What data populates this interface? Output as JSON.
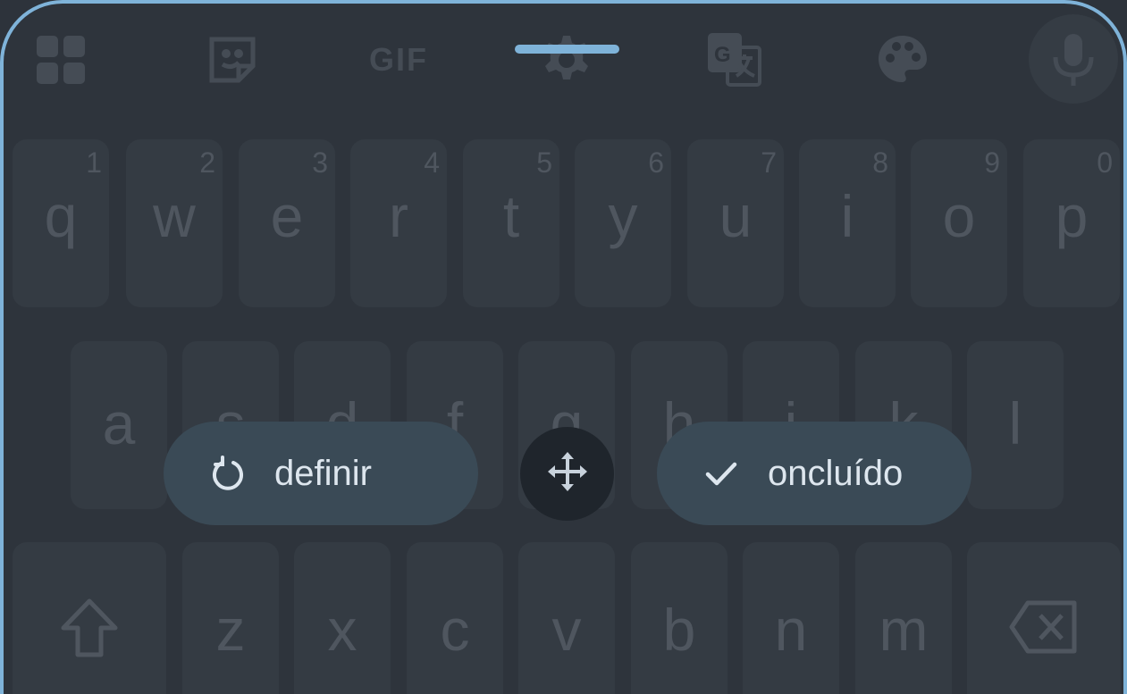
{
  "toolbar": {
    "icons": [
      "apps-grid-icon",
      "sticker-icon",
      "gif-icon",
      "settings-icon",
      "translate-icon",
      "palette-icon",
      "mic-icon"
    ],
    "gif_label": "GIF"
  },
  "keyboard": {
    "row1": [
      {
        "ch": "q",
        "num": "1"
      },
      {
        "ch": "w",
        "num": "2"
      },
      {
        "ch": "e",
        "num": "3"
      },
      {
        "ch": "r",
        "num": "4"
      },
      {
        "ch": "t",
        "num": "5"
      },
      {
        "ch": "y",
        "num": "6"
      },
      {
        "ch": "u",
        "num": "7"
      },
      {
        "ch": "i",
        "num": "8"
      },
      {
        "ch": "o",
        "num": "9"
      },
      {
        "ch": "p",
        "num": "0"
      }
    ],
    "row2": [
      "a",
      "s",
      "d",
      "f",
      "g",
      "h",
      "j",
      "k",
      "l"
    ],
    "row3": [
      "z",
      "x",
      "c",
      "v",
      "b",
      "n",
      "m"
    ],
    "shift_icon": "shift-icon",
    "backspace_icon": "backspace-icon"
  },
  "resize_controls": {
    "reset_label": "definir",
    "done_label": "oncluído",
    "move_icon": "move-arrows-icon"
  },
  "colors": {
    "accent": "#7fb3d9",
    "pill_bg": "#3a4a56",
    "key_bg": "#343b43"
  }
}
